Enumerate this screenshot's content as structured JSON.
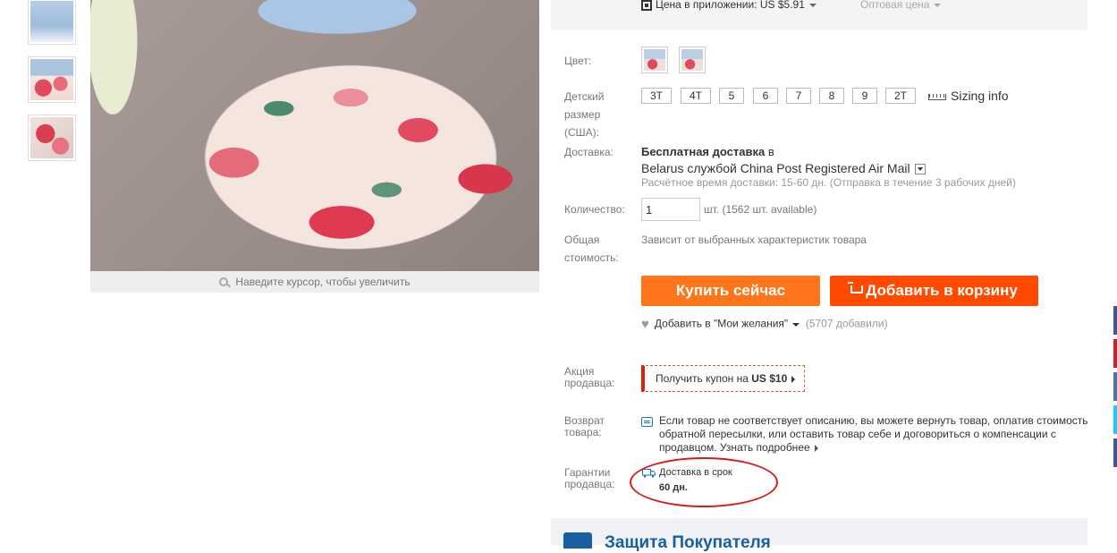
{
  "gallery": {
    "zoom_hint": "Наведите курсор, чтобы увеличить"
  },
  "price": {
    "app_price": "Цена в приложении: US $5.91",
    "wholesale": "Оптовая цена"
  },
  "options": {
    "color_label": "Цвет:",
    "size_label_lines": [
      "Детский",
      "размер",
      "(США):"
    ],
    "sizes": [
      "3T",
      "4T",
      "5",
      "6",
      "7",
      "8",
      "9",
      "2T"
    ],
    "sizing_info": "Sizing info"
  },
  "shipping": {
    "label": "Доставка:",
    "free": "Бесплатная доставка",
    "to": "в",
    "method": "Belarus службой China Post Registered Air Mail",
    "time": "Расчётное время доставки: 15-60 дн. (Отправка в течение 3 рабочих дней)"
  },
  "quantity": {
    "label": "Количество:",
    "value": "1",
    "unit_text": "шт. (1562 шт. available)"
  },
  "total": {
    "label_lines": [
      "Общая",
      "стоимость:"
    ],
    "text": "Зависит от выбранных характеристик товара"
  },
  "actions": {
    "buy_now": "Купить сейчас",
    "add_to_cart": "Добавить в корзину",
    "wishlist": "Добавить в \"Мои желания\"",
    "wishlist_count": "(5707 добавили)"
  },
  "promo": {
    "label_lines": [
      "Акция",
      "продавца:"
    ],
    "coupon_prefix": "Получить купон на",
    "coupon_amount": "US $10"
  },
  "returns": {
    "label_lines": [
      "Возврат",
      "товара:"
    ],
    "text": "Если товар не соответствует описанию, вы можете вернуть товар, оплатив стоимость обратной пересылки, или оставить товар себе и договориться о компенсации с продавцом.",
    "link": "Узнать подробнее"
  },
  "guarantee": {
    "label_lines": [
      "Гарантии",
      "продавца:"
    ],
    "line1": "Доставка в срок",
    "line2": "60 дн."
  },
  "protection": {
    "title": "Защита Покупателя"
  },
  "colors": {
    "buy_now": "#ff7519",
    "add_to_cart": "#ff4a00",
    "accent_blue": "#1a5fa0",
    "highlight_circle": "#d41c1c"
  }
}
